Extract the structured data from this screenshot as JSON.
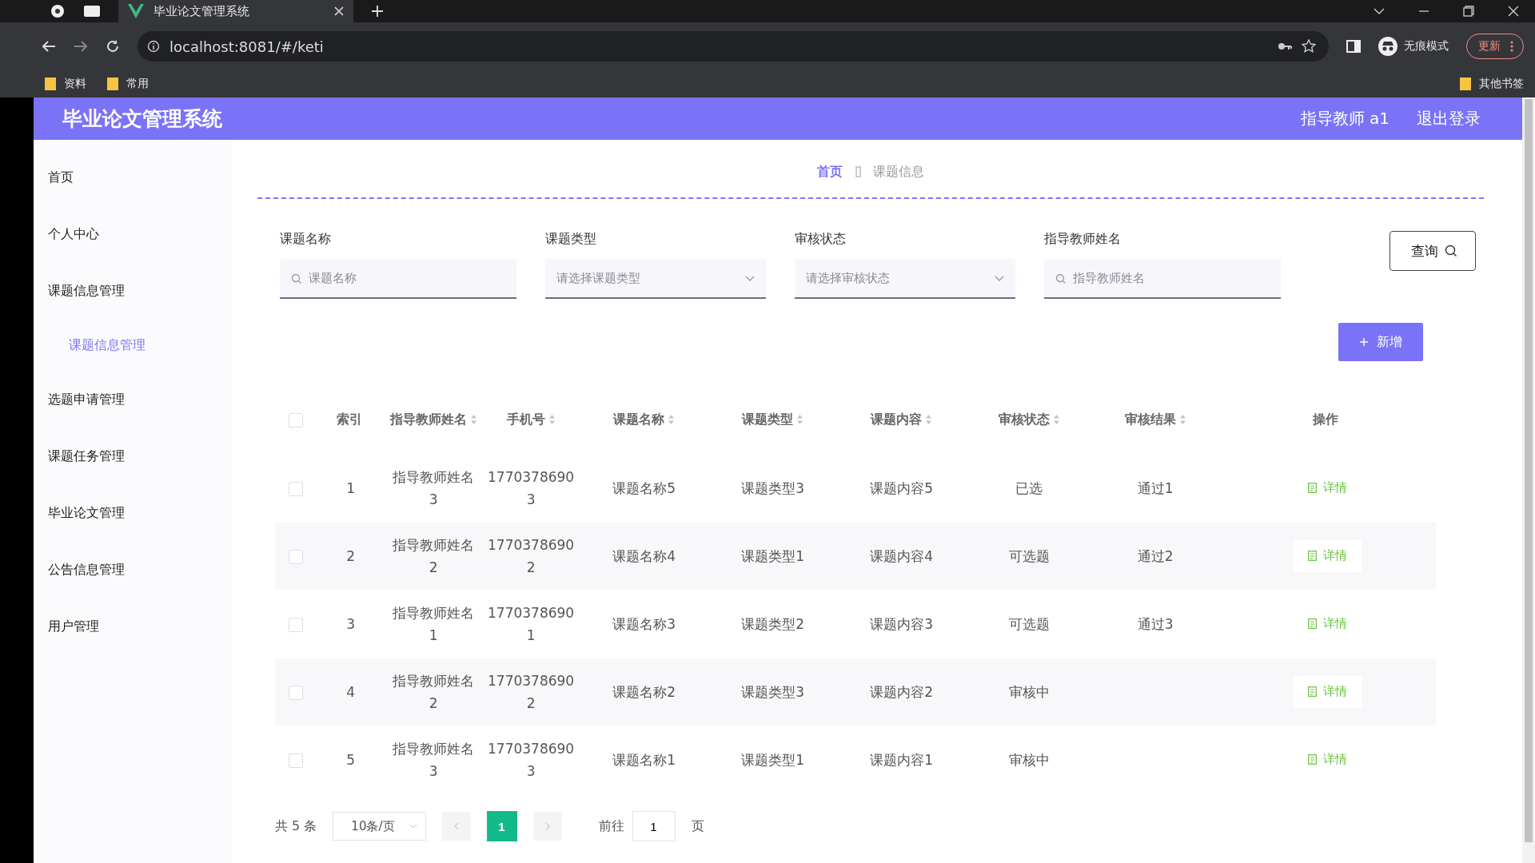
{
  "browser": {
    "tabs": [
      {
        "title": "毕业论文管理系统",
        "selected": true
      }
    ],
    "url": "localhost:8081/#/keti",
    "incognito_label": "无痕模式",
    "update_label": "更新",
    "bookmarks": [
      "资料",
      "常用"
    ],
    "other_bookmarks": "其他书签"
  },
  "header": {
    "title": "毕业论文管理系统",
    "user": "指导教师 a1",
    "logout": "退出登录"
  },
  "sidebar": {
    "items": [
      {
        "label": "首页",
        "selected": false
      },
      {
        "label": "个人中心",
        "selected": false
      },
      {
        "label": "课题信息管理",
        "selected": false,
        "children": [
          {
            "label": "课题信息管理",
            "selected": true
          }
        ]
      },
      {
        "label": "选题申请管理",
        "selected": false
      },
      {
        "label": "课题任务管理",
        "selected": false
      },
      {
        "label": "毕业论文管理",
        "selected": false
      },
      {
        "label": "公告信息管理",
        "selected": false
      },
      {
        "label": "用户管理",
        "selected": false
      }
    ]
  },
  "breadcrumb": [
    {
      "label": "首页",
      "selected": true
    },
    {
      "label": "课题信息",
      "selected": false
    }
  ],
  "filters": [
    {
      "kind": "text",
      "label": "课题名称",
      "placeholder": "课题名称"
    },
    {
      "kind": "select",
      "label": "课题类型",
      "placeholder": "请选择课题类型"
    },
    {
      "kind": "select",
      "label": "审核状态",
      "placeholder": "请选择审核状态"
    },
    {
      "kind": "text",
      "label": "指导教师姓名",
      "placeholder": "指导教师姓名"
    }
  ],
  "query_button": "查询",
  "add_button": "新增",
  "table": {
    "columns": [
      {
        "label": "索引",
        "sortable": false
      },
      {
        "label": "指导教师姓名",
        "sortable": true
      },
      {
        "label": "手机号",
        "sortable": true
      },
      {
        "label": "课题名称",
        "sortable": true
      },
      {
        "label": "课题类型",
        "sortable": true
      },
      {
        "label": "课题内容",
        "sortable": true
      },
      {
        "label": "审核状态",
        "sortable": true
      },
      {
        "label": "审核结果",
        "sortable": true
      },
      {
        "label": "操作",
        "sortable": false
      }
    ],
    "all_checked": false,
    "rows": [
      {
        "checked": false,
        "cells": [
          "1",
          "指导教师姓名3",
          "17703786903",
          "课题名称5",
          "课题类型3",
          "课题内容5",
          "已选",
          "通过1"
        ],
        "action": "详情"
      },
      {
        "checked": false,
        "cells": [
          "2",
          "指导教师姓名2",
          "17703786902",
          "课题名称4",
          "课题类型1",
          "课题内容4",
          "可选题",
          "通过2"
        ],
        "action": "详情"
      },
      {
        "checked": false,
        "cells": [
          "3",
          "指导教师姓名1",
          "17703786901",
          "课题名称3",
          "课题类型2",
          "课题内容3",
          "可选题",
          "通过3"
        ],
        "action": "详情"
      },
      {
        "checked": false,
        "cells": [
          "4",
          "指导教师姓名2",
          "17703786902",
          "课题名称2",
          "课题类型3",
          "课题内容2",
          "审核中",
          ""
        ],
        "action": "详情"
      },
      {
        "checked": false,
        "cells": [
          "5",
          "指导教师姓名3",
          "17703786903",
          "课题名称1",
          "课题类型1",
          "课题内容1",
          "审核中",
          ""
        ],
        "action": "详情"
      }
    ]
  },
  "pagination": {
    "total": "共 5 条",
    "page_size": "10条/页",
    "pages": [
      {
        "label": "1",
        "selected": true
      }
    ],
    "goto_label": "前往",
    "goto_value": "1",
    "goto_suffix": "页"
  }
}
